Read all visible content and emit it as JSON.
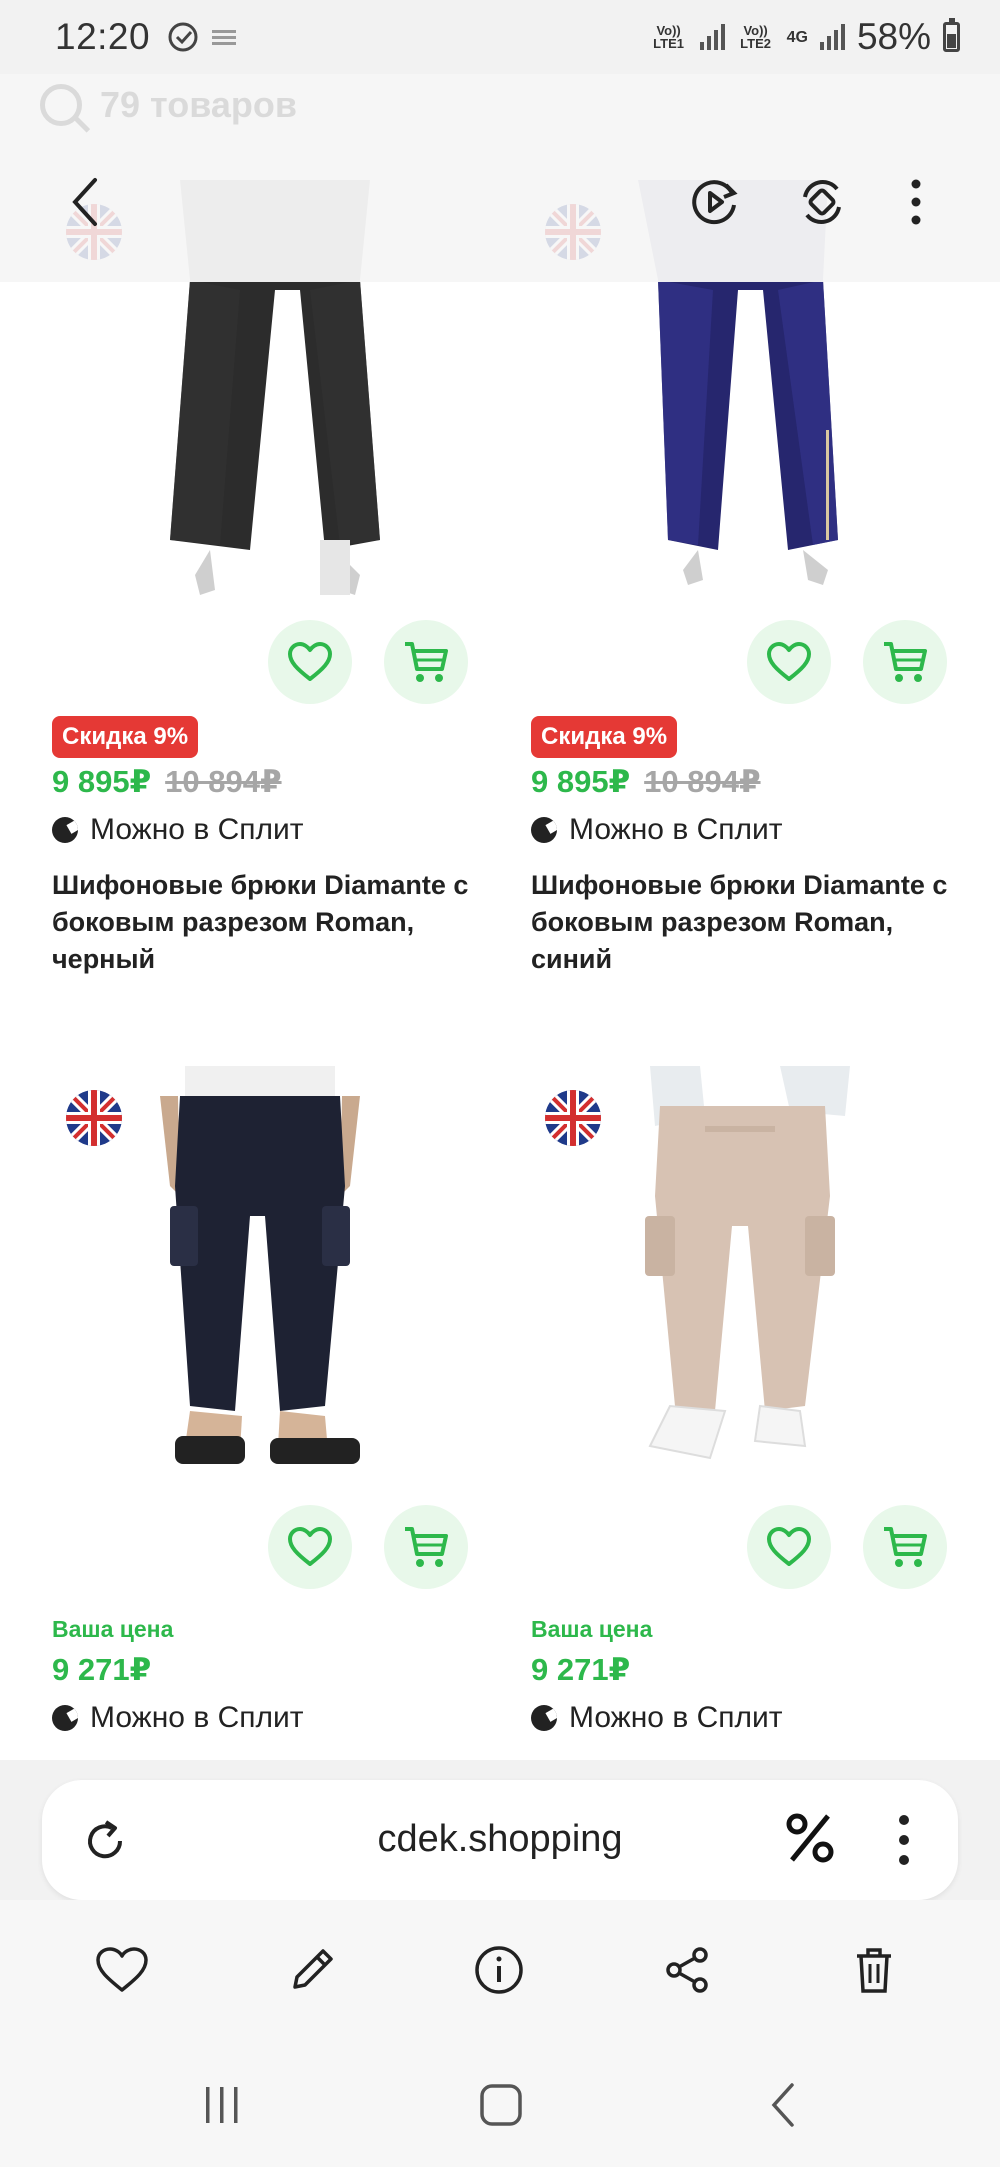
{
  "status_bar": {
    "time": "12:20",
    "sim1_label": "Vo)) LTE1",
    "sim2_label": "Vo)) LTE2",
    "sim2_tech": "4G",
    "battery": "58%"
  },
  "search": {
    "placeholder": "79 товаров"
  },
  "products": [
    {
      "discount_badge": "Скидка 9%",
      "price": "9 895₽",
      "old_price": "10 894₽",
      "split": "Можно в Сплит",
      "title": "Шифоновые брюки Diamante с боковым разрезом Roman, черный"
    },
    {
      "discount_badge": "Скидка 9%",
      "price": "9 895₽",
      "old_price": "10 894₽",
      "split": "Можно в Сплит",
      "title": "Шифоновые брюки Diamante с боковым разрезом Roman, синий"
    },
    {
      "your_price_label": "Ваша цена",
      "price": "9 271₽",
      "split": "Можно в Сплит"
    },
    {
      "your_price_label": "Ваша цена",
      "price": "9 271₽",
      "split": "Можно в Сплит"
    }
  ],
  "browser": {
    "url": "cdek.shopping"
  },
  "icons": {
    "favorite": "heart-icon",
    "cart": "cart-icon",
    "flag": "uk-flag-icon",
    "reload": "reload-icon",
    "percent": "percent-icon",
    "more": "more-vertical-icon",
    "back": "chevron-left-icon",
    "edit": "pencil-icon",
    "info": "info-icon",
    "share": "share-icon",
    "delete": "trash-icon"
  },
  "colors": {
    "accent_green": "#2db84b",
    "sale_red": "#e53935",
    "fab_bg": "#e8f8ea"
  }
}
